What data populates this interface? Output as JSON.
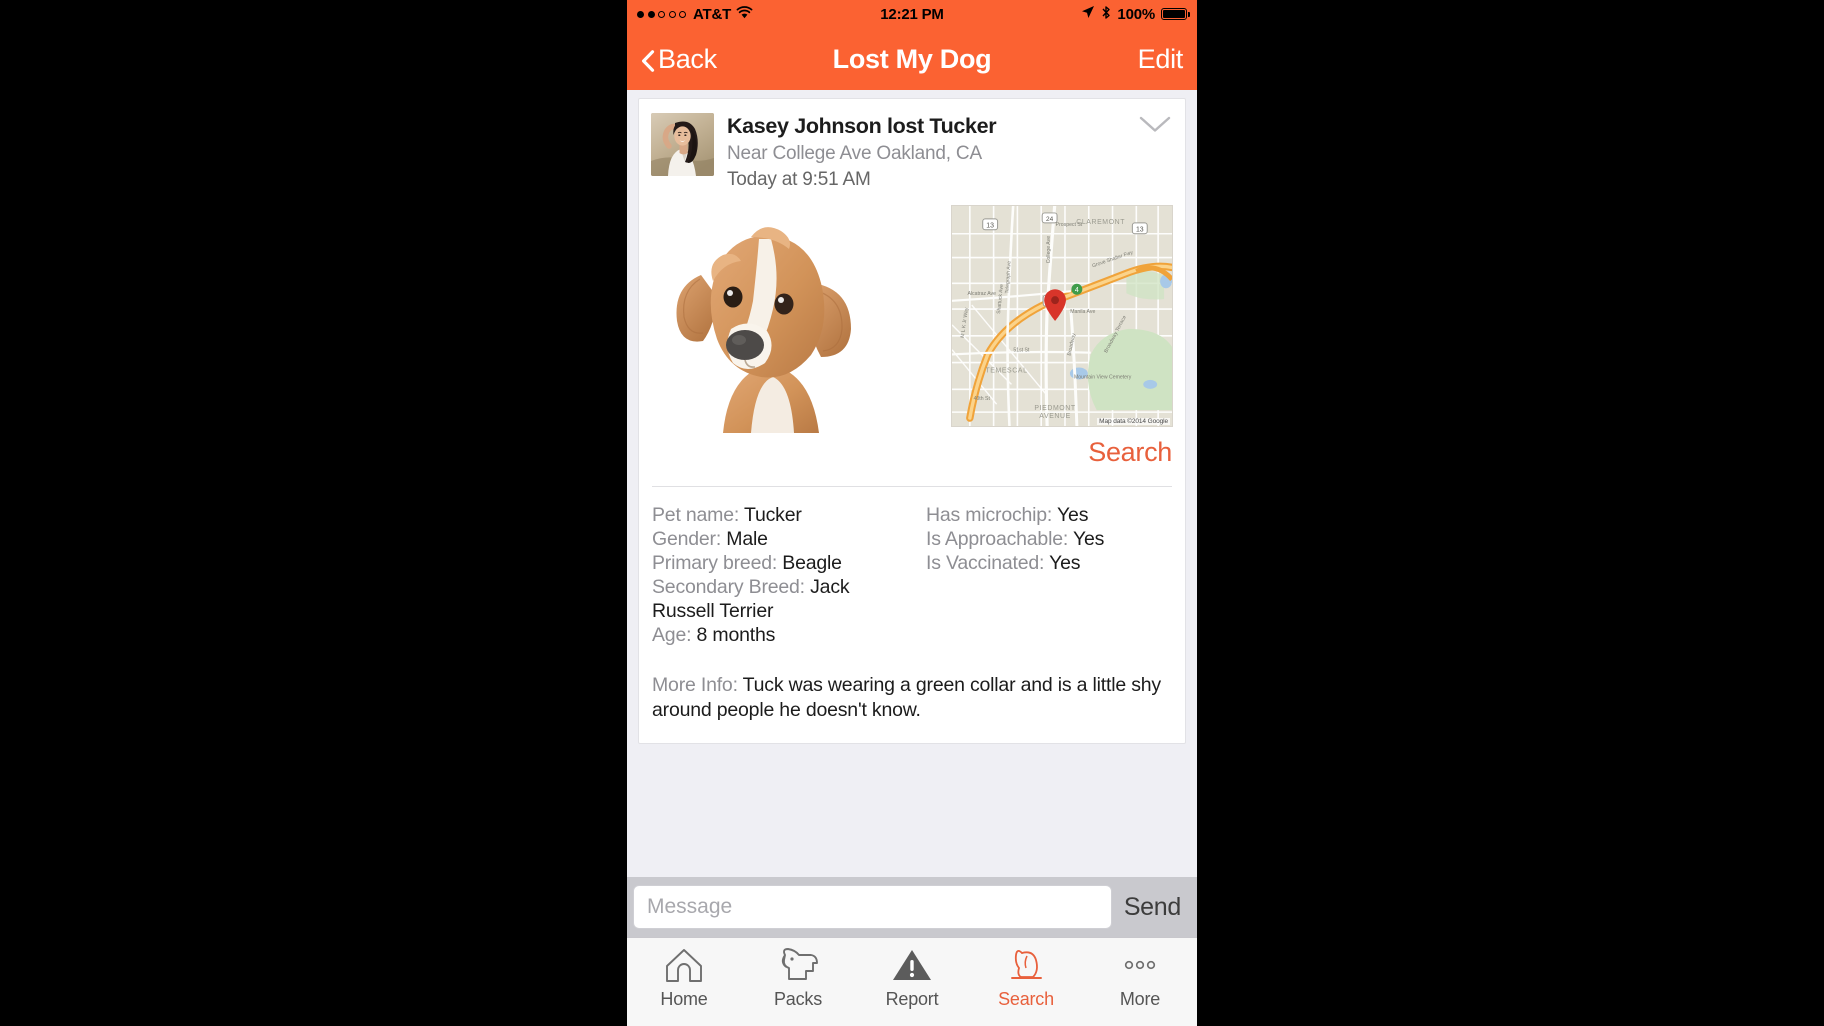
{
  "theme": {
    "accent": "#fb6232",
    "link": "#e8603c",
    "page_bg": "#efeff4",
    "card_bg": "#ffffff",
    "muted_text": "#8e8e93",
    "body_text": "#1c1c1c",
    "msgbar_bg": "#c9c9ce",
    "tabbar_bg": "#f7f7f7"
  },
  "status_bar": {
    "signal_dots_filled": 2,
    "signal_dots_total": 5,
    "carrier": "AT&T",
    "wifi_icon": "wifi-icon",
    "time": "12:21 PM",
    "location_icon": "location-arrow-icon",
    "bluetooth_icon": "bluetooth-icon",
    "battery_percent": "100%",
    "battery_icon": "battery-full-icon"
  },
  "nav_bar": {
    "back_label": "Back",
    "back_icon": "chevron-left-icon",
    "title": "Lost My Dog",
    "edit_label": "Edit"
  },
  "post": {
    "avatar_name": "avatar",
    "title": "Kasey Johnson lost Tucker",
    "location": "Near College Ave Oakland, CA",
    "timestamp": "Today at 9:51 AM",
    "collapse_icon": "chevron-down-icon",
    "pet_photo_name": "pet-photo",
    "map": {
      "name": "map-thumbnail",
      "pin_icon": "map-pin-icon",
      "credit": "Map data ©2014 Google",
      "labels": [
        "CLAREMONT",
        "TEMESCAL",
        "PIEDMONT AVENUE",
        "Mountain View Cemetery",
        "Grove Shafter Fwy",
        "College Ave",
        "Broadway",
        "Telegraph Ave",
        "51st St",
        "40th St",
        "M L K Jr Way"
      ]
    },
    "search_link": "Search"
  },
  "details": {
    "left_column": [
      {
        "label": "Pet name:",
        "value": "Tucker"
      },
      {
        "label": "Gender:",
        "value": "Male"
      },
      {
        "label": "Primary breed:",
        "value": "Beagle"
      },
      {
        "label": "Secondary Breed:",
        "value": "Jack Russell Terrier"
      },
      {
        "label": "Age:",
        "value": "8 months"
      }
    ],
    "right_column": [
      {
        "label": "Has microchip:",
        "value": "Yes"
      },
      {
        "label": "Is Approachable:",
        "value": "Yes"
      },
      {
        "label": "Is Vaccinated:",
        "value": "Yes"
      }
    ],
    "more_info_label": "More Info:",
    "more_info_value": "Tuck was wearing a green collar and is a little shy around people he doesn't know."
  },
  "message_bar": {
    "input_value": "",
    "input_placeholder": "Message",
    "send_label": "Send"
  },
  "tab_bar": {
    "items": [
      {
        "label": "Home",
        "icon": "home-icon",
        "active": false
      },
      {
        "label": "Packs",
        "icon": "dog-head-icon",
        "active": false
      },
      {
        "label": "Report",
        "icon": "warning-triangle-icon",
        "active": false
      },
      {
        "label": "Search",
        "icon": "dog-sitting-icon",
        "active": true
      },
      {
        "label": "More",
        "icon": "ellipsis-icon",
        "active": false
      }
    ]
  }
}
